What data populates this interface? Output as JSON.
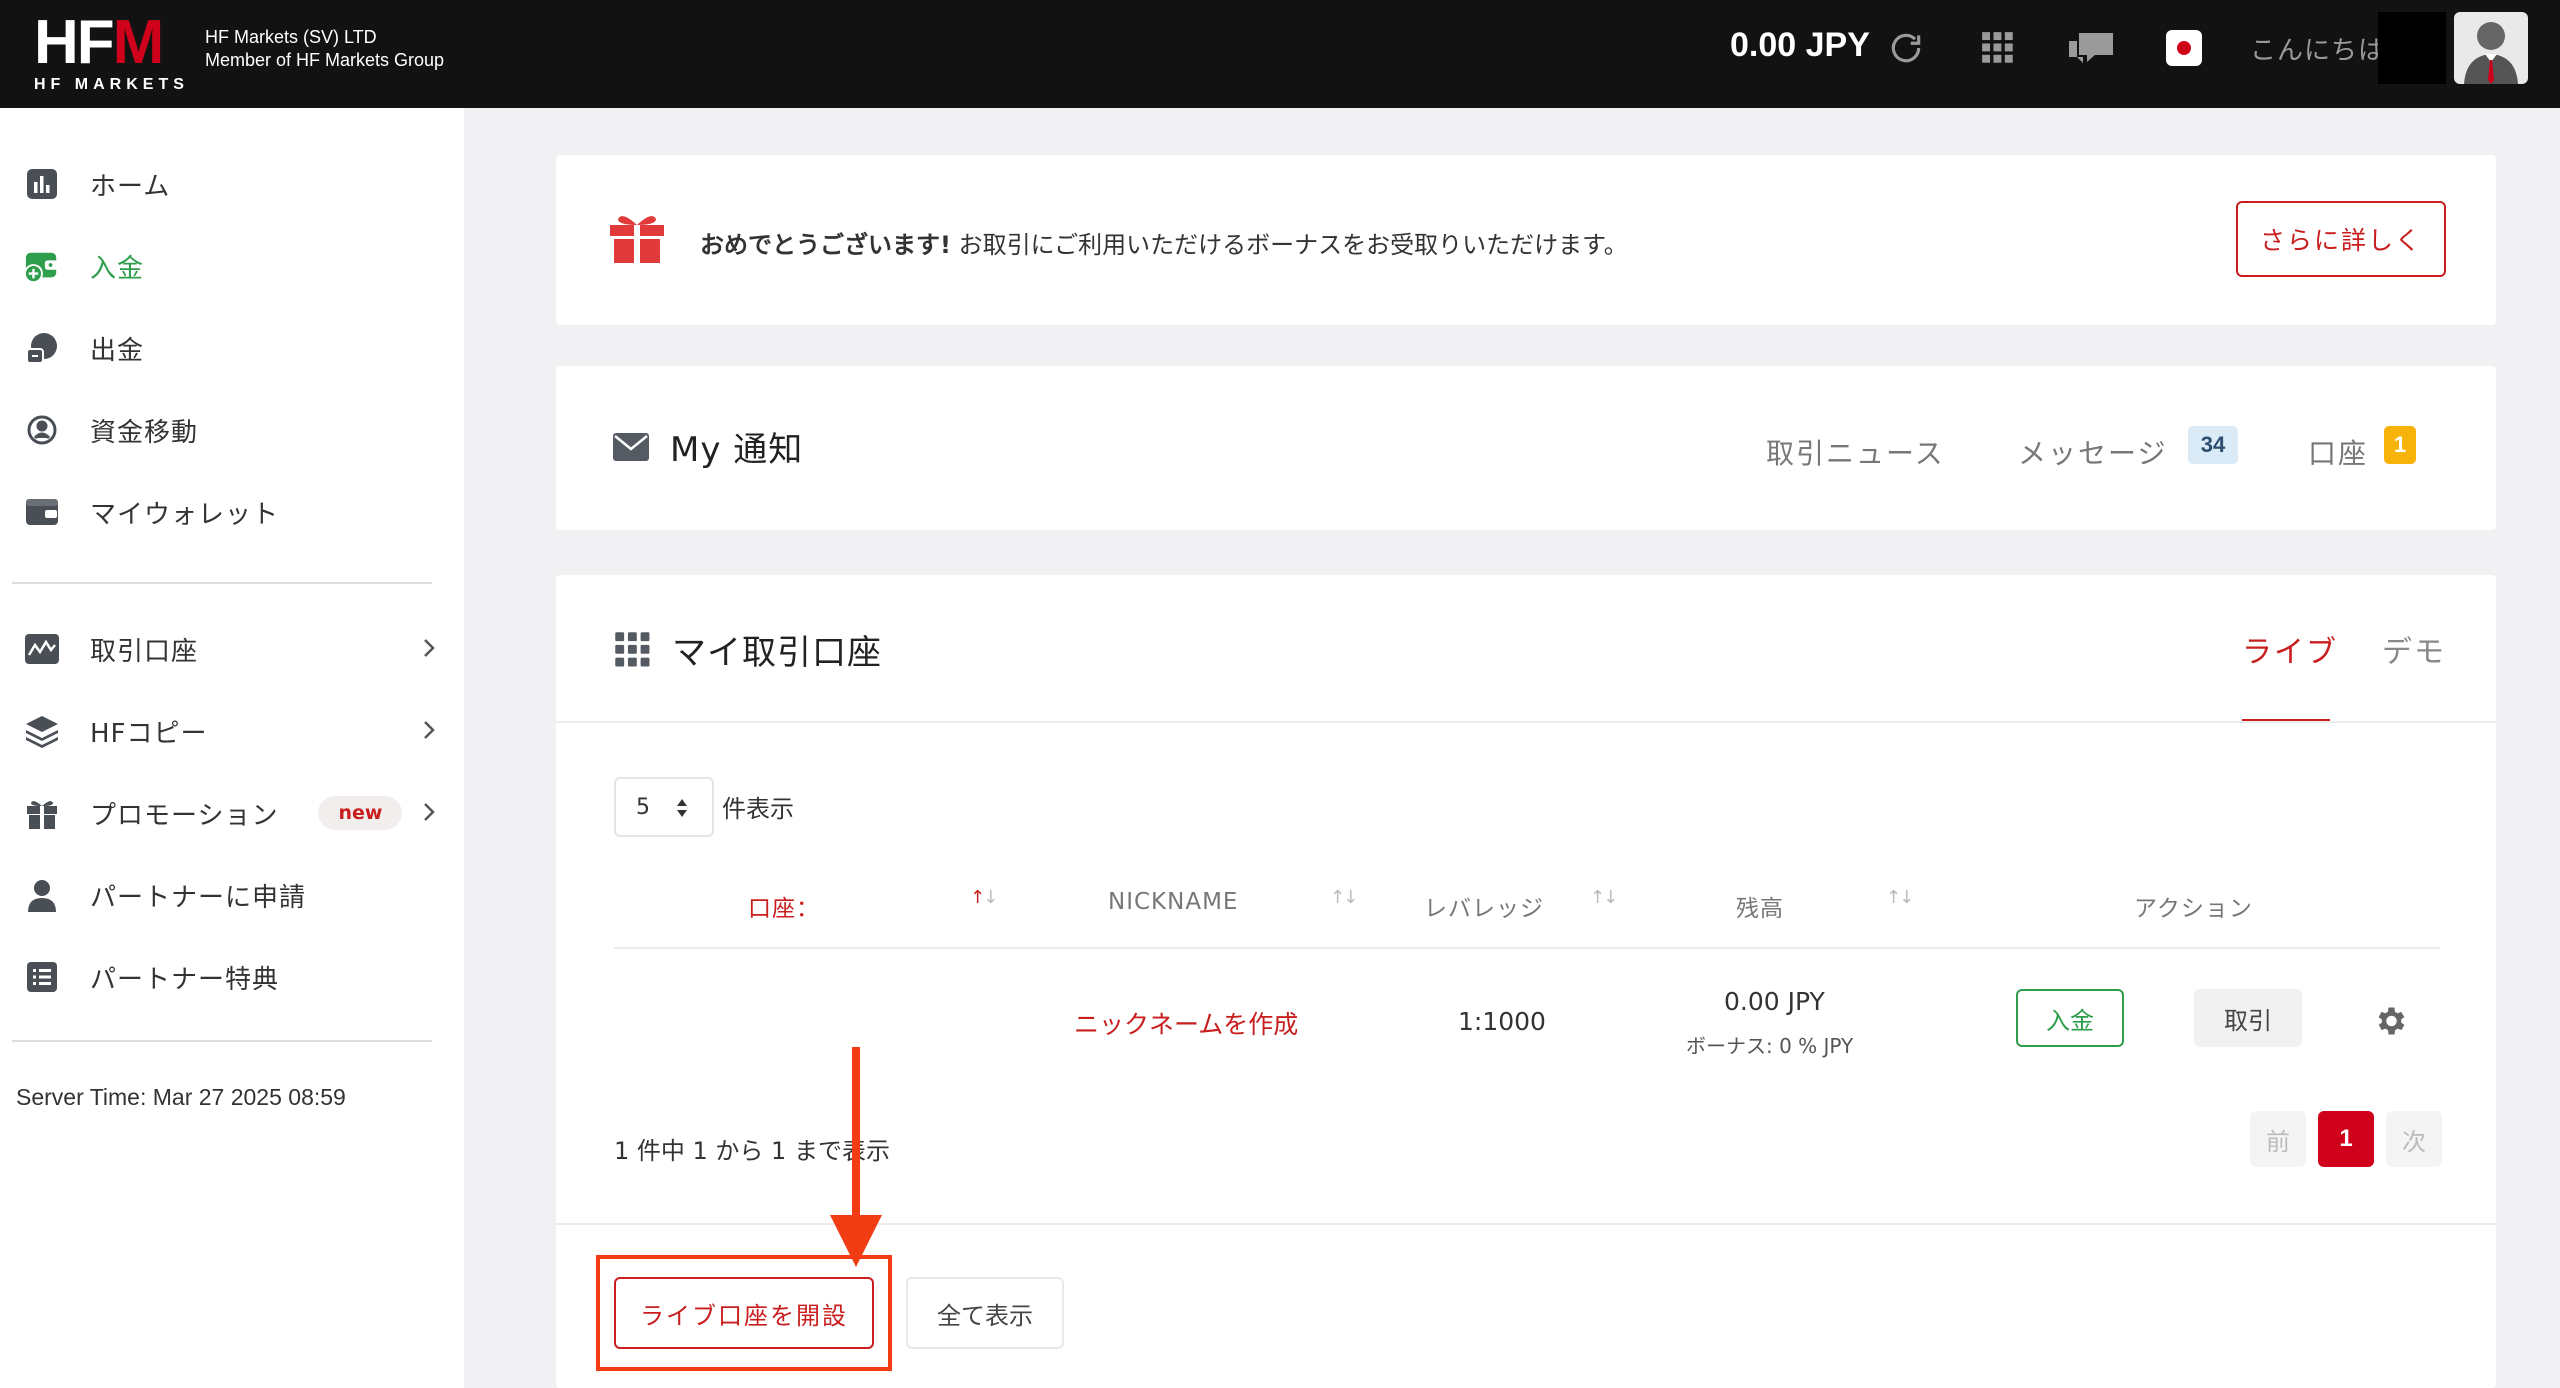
{
  "header": {
    "logo_text": "HFM",
    "logo_subtext": "HF MARKETS",
    "company_line1": "HF Markets (SV) LTD",
    "company_line2": "Member of HF Markets Group",
    "balance": "0.00 JPY",
    "greeting": "こんにちは"
  },
  "sidebar": {
    "items": [
      {
        "label": "ホーム",
        "icon": "chart-icon"
      },
      {
        "label": "入金",
        "icon": "wallet-add-icon"
      },
      {
        "label": "出金",
        "icon": "withdraw-icon"
      },
      {
        "label": "資金移動",
        "icon": "transfer-icon"
      },
      {
        "label": "マイウォレット",
        "icon": "wallet-icon"
      },
      {
        "label": "取引口座",
        "icon": "trading-account-icon"
      },
      {
        "label": "HFコピー",
        "icon": "layers-icon"
      },
      {
        "label": "プロモーション",
        "icon": "gift-icon",
        "badge": "new"
      },
      {
        "label": "パートナーに申請",
        "icon": "user-icon"
      },
      {
        "label": "パートナー特典",
        "icon": "list-icon"
      }
    ],
    "server_time": "Server Time: Mar 27 2025 08:59"
  },
  "bonus": {
    "bold": "おめでとうございます!",
    "text": " お取引にご利用いただけるボーナスをお受取りいただけます。",
    "more_label": "さらに詳しく"
  },
  "notifications": {
    "title": "My 通知",
    "trade_news": "取引ニュース",
    "messages": "メッセージ",
    "messages_count": "34",
    "accounts": "口座",
    "accounts_count": "1"
  },
  "accounts": {
    "title": "マイ取引口座",
    "tab_live": "ライブ",
    "tab_demo": "デモ",
    "page_size": "5",
    "page_size_suffix": "件表示",
    "columns": [
      "口座：",
      "NICKNAME",
      "レバレッジ",
      "残高",
      "アクション"
    ],
    "row": {
      "nickname": "ニックネームを作成",
      "leverage": "1:1000",
      "balance": "0.00 JPY",
      "bonus": "ボーナス: 0 % JPY",
      "deposit_label": "入金",
      "trade_label": "取引"
    },
    "summary": "1 件中 1 から 1 まで表示",
    "pagination": {
      "prev": "前",
      "current": "1",
      "next": "次"
    },
    "open_live_label": "ライブ口座を開設",
    "show_all_label": "全て表示"
  },
  "colors": {
    "accent_red": "#c81e1e",
    "green": "#2e9e4c",
    "annotation": "#f23c14"
  }
}
